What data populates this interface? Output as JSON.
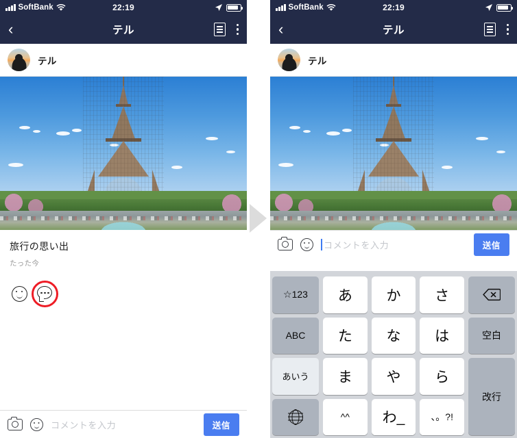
{
  "status_bar": {
    "carrier": "SoftBank",
    "time": "22:19",
    "signal_icon": "signal-bars-icon",
    "wifi_icon": "wifi-icon",
    "location_icon": "location-arrow-icon",
    "battery_icon": "battery-icon"
  },
  "nav_bar": {
    "back_icon": "chevron-left-icon",
    "title": "テル",
    "list_icon": "list-icon",
    "menu_icon": "more-vertical-icon"
  },
  "user_row": {
    "avatar_icon": "avatar",
    "name": "テル"
  },
  "photo": {
    "alt": "eiffel-tower-photo"
  },
  "post": {
    "title": "旅行の思い出",
    "timestamp": "たった今",
    "like_icon": "smiley-icon",
    "comment_icon": "comment-bubble-icon",
    "highlight_color": "#ee1c25"
  },
  "comment_bar": {
    "camera_icon": "camera-icon",
    "sticker_icon": "smiley-icon",
    "placeholder": "コメントを入力",
    "value": "",
    "send_label": "送信",
    "send_color": "#4a7df0"
  },
  "keyboard": {
    "rows": [
      [
        {
          "label": "☆123",
          "type": "fn"
        },
        {
          "label": "あ",
          "type": "char"
        },
        {
          "label": "か",
          "type": "char"
        },
        {
          "label": "さ",
          "type": "char"
        },
        {
          "label": "delete-icon",
          "type": "fn-icon"
        }
      ],
      [
        {
          "label": "ABC",
          "type": "fn"
        },
        {
          "label": "た",
          "type": "char"
        },
        {
          "label": "な",
          "type": "char"
        },
        {
          "label": "は",
          "type": "char"
        },
        {
          "label": "空白",
          "type": "fn"
        }
      ],
      [
        {
          "label": "あいう",
          "type": "fn-light"
        },
        {
          "label": "ま",
          "type": "char"
        },
        {
          "label": "や",
          "type": "char"
        },
        {
          "label": "ら",
          "type": "char"
        },
        {
          "label": "改行",
          "type": "fn-tall"
        }
      ],
      [
        {
          "label": "globe-icon",
          "type": "fn-icon"
        },
        {
          "label": "^^",
          "type": "char-sm"
        },
        {
          "label": "わ_",
          "type": "char"
        },
        {
          "label": "、。?!",
          "type": "char-sm"
        }
      ]
    ]
  },
  "arrow": {
    "name": "step-arrow",
    "color": "#dcdcdc"
  }
}
